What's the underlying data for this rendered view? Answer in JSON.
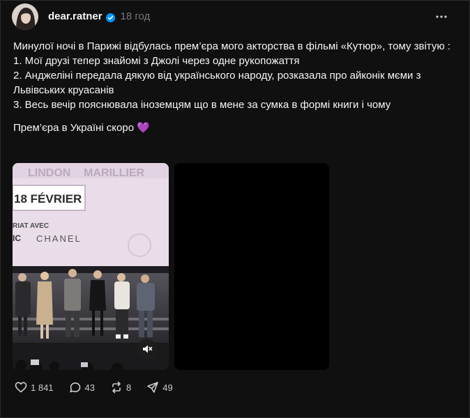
{
  "post": {
    "username": "dear.ratner",
    "time": "18 год",
    "lines": [
      "Минулої ночі в Парижі відбулась прем’єра мого акторства в фільмі «Кутюр», тому звітую :",
      "1. Мої друзі тепер знайомі з Джолі через одне рукопожаття",
      "2. Анджеліні передала дякую від українського народу, розказала про айконік мєми з Львівських круасанів",
      "3. Весь вечір пояснювала іноземцям що в мене за сумка в формі книги і чому"
    ],
    "footer_line": "Прем’єра в Україні скоро 💜"
  },
  "media": {
    "poster_text": {
      "names_left": "LINDON",
      "names_right": "MARILLIER",
      "date": "18 FÉVRIER",
      "partner_line": "RIAT AVEC",
      "brand": "CHANEL"
    }
  },
  "actions": {
    "likes": "1 841",
    "comments": "43",
    "reposts": "8",
    "shares": "49"
  },
  "colors": {
    "background": "#101010",
    "text": "#f3f5f7",
    "muted": "#777777",
    "verified": "#0095f6"
  },
  "icons": [
    "more-icon",
    "verified-icon",
    "heart-icon",
    "comment-icon",
    "repost-icon",
    "share-icon",
    "mute-icon"
  ]
}
